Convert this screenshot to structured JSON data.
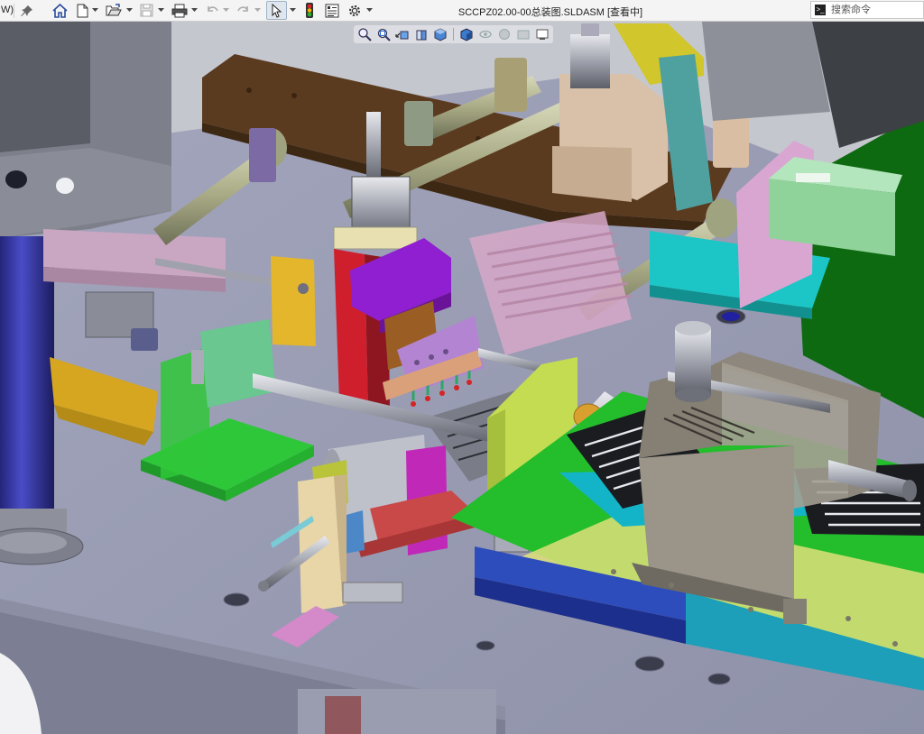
{
  "titlebar": {
    "cut_label": "W)",
    "document_title": "SCCPZ02.00-00总装图.SLDASM [查看中]"
  },
  "command_search": {
    "placeholder": "搜索命令"
  },
  "toolbar": {
    "icons": [
      "pin-icon",
      "home-icon",
      "new-document-icon",
      "open-folder-icon",
      "save-icon",
      "print-icon",
      "undo-icon",
      "redo-icon",
      "select-cursor-icon",
      "traffic-light-icon",
      "file-properties-icon",
      "gear-icon"
    ]
  },
  "heads_up_toolbar": {
    "icons": [
      "zoom-to-fit-icon",
      "zoom-area-icon",
      "previous-view-icon",
      "section-view-icon",
      "view-orientation-icon",
      "display-style-icon",
      "hide-show-icon",
      "edit-appearance-icon",
      "apply-scene-icon",
      "view-settings-icon"
    ]
  },
  "colors": {
    "toolbar_bg": "#f4f4f4",
    "viewport_bg": "#c9cbd3",
    "table_top": "#9b9eb6",
    "accent_green": "#28c02c",
    "accent_purple": "#8f1fd0",
    "accent_brown": "#5a3a1e",
    "accent_cyan": "#1cc6c6"
  }
}
